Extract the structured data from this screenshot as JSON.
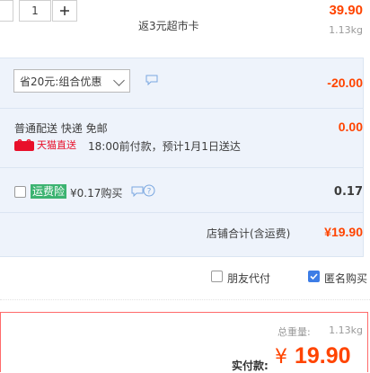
{
  "item": {
    "quantity": "1",
    "price": "39.90",
    "weight": "1.13kg",
    "gift_note": "返3元超市卡"
  },
  "promo": {
    "selected_option": "省20元:组合优惠",
    "discount": "-20.00"
  },
  "shipping": {
    "method": "普通配送 快递 免邮",
    "fee": "0.00",
    "tmall_badge": "天猫直送",
    "delivery_note": "18:00前付款，预计1月1日送达"
  },
  "insurance": {
    "tag": "运费险",
    "price_label": "¥0.17购买",
    "value": "0.17"
  },
  "store_total": {
    "label": "店铺合计(含运费)",
    "value": "¥19.90"
  },
  "options": {
    "friend_pay_label": "朋友代付",
    "anonymous_label": "匿名购买",
    "anonymous_checked": true
  },
  "summary": {
    "total_weight_label": "总重量:",
    "total_weight": "1.13kg",
    "pay_label": "实付款:",
    "currency": "¥",
    "pay_amount": "19.90"
  },
  "colors": {
    "accent_red": "#ff4400",
    "check_blue": "#3d7de6",
    "band_blue": "#eef3fb"
  }
}
